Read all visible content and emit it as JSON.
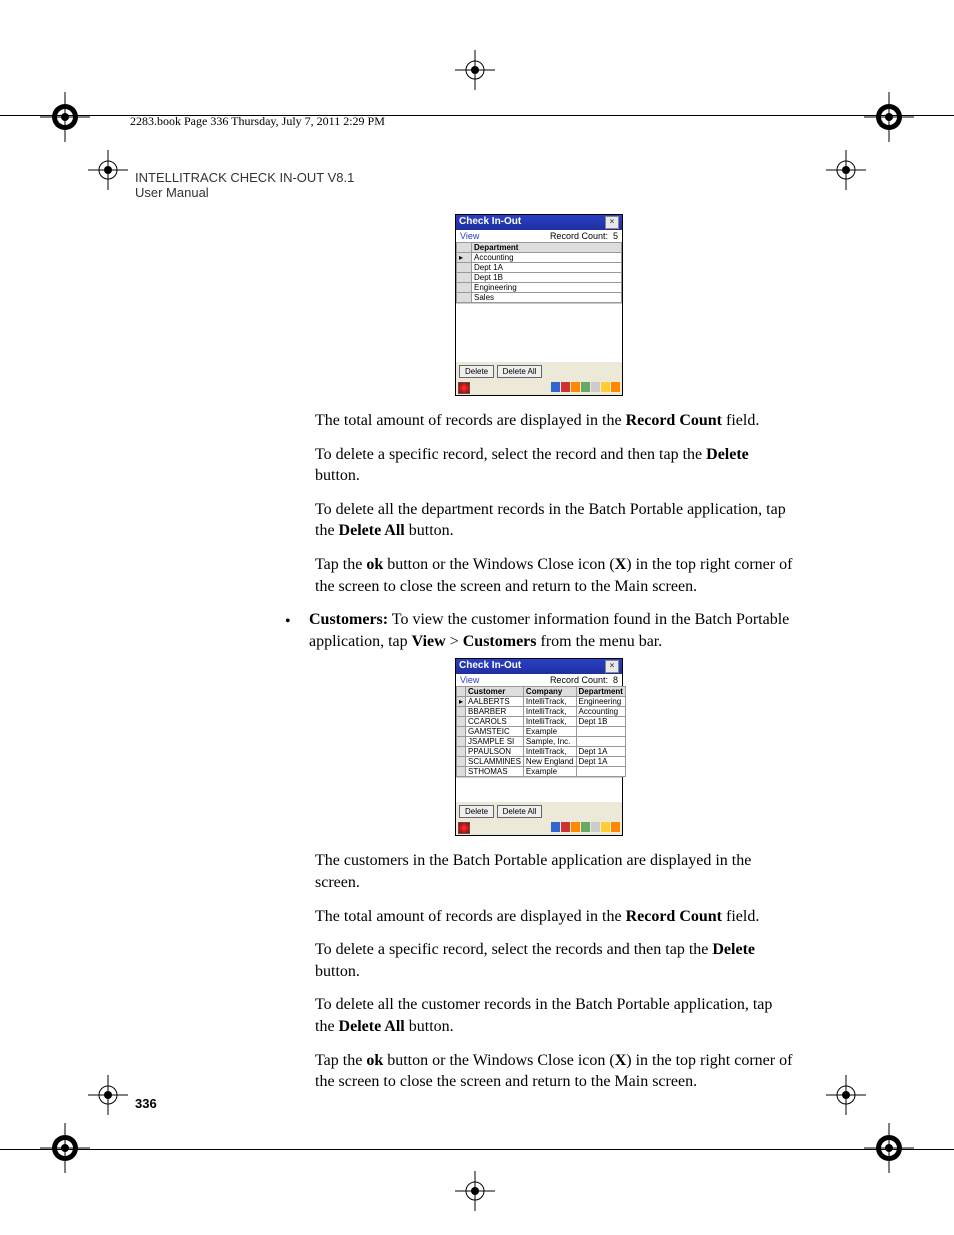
{
  "header_line": "2283.book  Page 336  Thursday, July 7, 2011  2:29 PM",
  "doc_title": "INTELLITRACK CHECK IN-OUT V8.1",
  "doc_subtitle": "User Manual",
  "page_number": "336",
  "screenshot1": {
    "title": "Check In-Out",
    "menu_view": "View",
    "record_count_label": "Record Count:",
    "record_count_value": "5",
    "headers": [
      "Department"
    ],
    "rows": [
      [
        "Accounting"
      ],
      [
        "Dept 1A"
      ],
      [
        "Dept 1B"
      ],
      [
        "Engineering"
      ],
      [
        "Sales"
      ]
    ],
    "btn_delete": "Delete",
    "btn_delete_all": "Delete All"
  },
  "screenshot2": {
    "title": "Check In-Out",
    "menu_view": "View",
    "record_count_label": "Record Count:",
    "record_count_value": "8",
    "headers": [
      "Customer",
      "Company",
      "Department"
    ],
    "rows": [
      [
        "AALBERTS",
        "IntelliTrack,",
        "Engineering"
      ],
      [
        "BBARBER",
        "IntelliTrack,",
        "Accounting"
      ],
      [
        "CCAROLS",
        "IntelliTrack,",
        "Dept 1B"
      ],
      [
        "GAMSTEIC",
        "Example",
        ""
      ],
      [
        "JSAMPLE SI",
        "Sample, Inc.",
        ""
      ],
      [
        "PPAULSON",
        "IntelliTrack,",
        "Dept 1A"
      ],
      [
        "SCLAMMINES",
        "New England",
        "Dept 1A"
      ],
      [
        "STHOMAS",
        "Example",
        ""
      ]
    ],
    "btn_delete": "Delete",
    "btn_delete_all": "Delete All"
  },
  "para1_a": "The total amount of records are displayed in the ",
  "para1_b": "Record Count",
  "para1_c": " field.",
  "para2_a": "To delete a specific record, select the record and then tap the ",
  "para2_b": "Delete",
  "para2_c": " button.",
  "para3_a": "To delete all the department records in the Batch Portable application, tap the ",
  "para3_b": "Delete All",
  "para3_c": " button.",
  "para4_a": "Tap the ",
  "para4_b": "ok",
  "para4_c": " button or the Windows Close icon (",
  "para4_d": "X",
  "para4_e": ") in the top right corner of the screen to close the screen and return to the Main screen.",
  "bullet_a": "Customers:",
  "bullet_b": " To view the customer information found in the Batch Portable application, tap ",
  "bullet_c": "View",
  "bullet_d": " > ",
  "bullet_e": "Customers",
  "bullet_f": " from the menu bar.",
  "para5": "The customers in the Batch Portable application are displayed in the screen.",
  "para6_a": "The total amount of records are displayed in the ",
  "para6_b": "Record Count",
  "para6_c": " field.",
  "para7_a": "To delete a specific record, select the records and then tap the ",
  "para7_b": "Delete",
  "para7_c": " button.",
  "para8_a": "To delete all the customer records in the Batch Portable application, tap the ",
  "para8_b": "Delete All",
  "para8_c": " button.",
  "para9_a": "Tap the ",
  "para9_b": "ok",
  "para9_c": " button or the Windows Close icon (",
  "para9_d": "X",
  "para9_e": ") in the top right corner of the screen to close the screen and return to the Main screen."
}
